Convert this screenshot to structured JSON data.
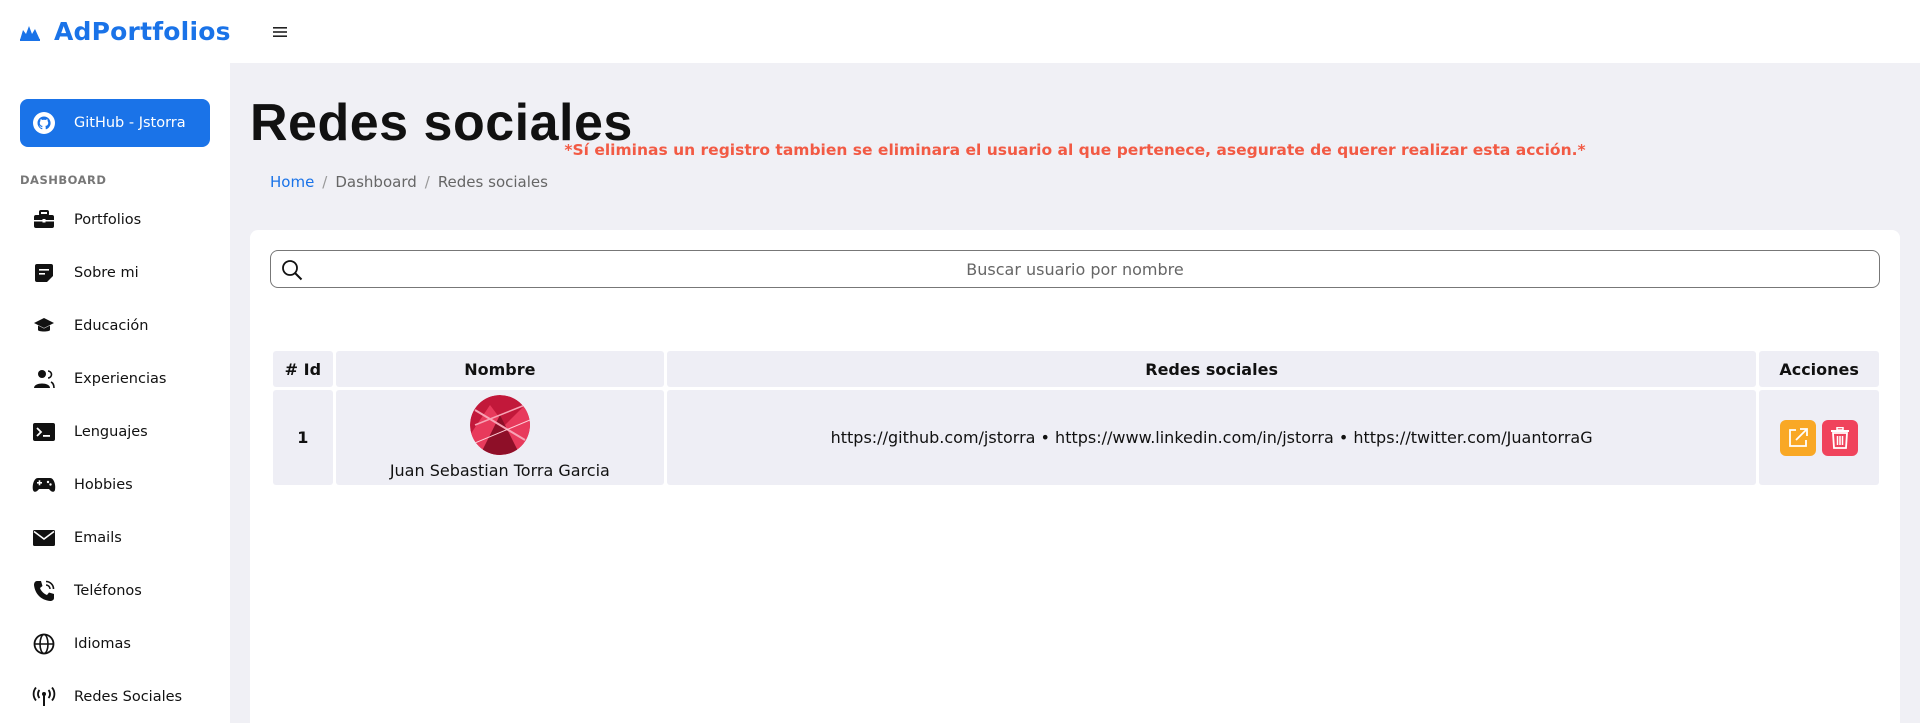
{
  "app": {
    "name": "AdPortfolios",
    "accent": "#1a73e8"
  },
  "sidebar": {
    "github_button": "GitHub - Jstorra",
    "section_label": "DASHBOARD",
    "items": [
      {
        "label": "Portfolios",
        "icon": "briefcase-icon"
      },
      {
        "label": "Sobre mi",
        "icon": "note-icon"
      },
      {
        "label": "Educación",
        "icon": "graduation-cap-icon"
      },
      {
        "label": "Experiencias",
        "icon": "person-icon"
      },
      {
        "label": "Lenguajes",
        "icon": "terminal-icon"
      },
      {
        "label": "Hobbies",
        "icon": "gamepad-icon"
      },
      {
        "label": "Emails",
        "icon": "envelope-icon"
      },
      {
        "label": "Teléfonos",
        "icon": "phone-icon"
      },
      {
        "label": "Idiomas",
        "icon": "globe-icon"
      },
      {
        "label": "Redes Sociales",
        "icon": "broadcast-icon"
      }
    ]
  },
  "main": {
    "title": "Redes sociales",
    "breadcrumb": [
      "Home",
      "Dashboard",
      "Redes sociales"
    ],
    "search_placeholder": "Buscar usuario por nombre",
    "warning": "*Sí eliminas un registro tambien se eliminara el usuario al que pertenece, asegurate de querer realizar esta acción.*",
    "warning_color": "#f25a44",
    "table": {
      "headers": [
        "# Id",
        "Nombre",
        "Redes sociales",
        "Acciones"
      ],
      "rows": [
        {
          "id": "1",
          "nombre": "Juan Sebastian Torra Garcia",
          "redes": "https://github.com/jstorra • https://www.linkedin.com/in/jstorra • https://twitter.com/JuantorraG"
        }
      ]
    },
    "edit_color": "#f9a825",
    "delete_color": "#f0435c"
  }
}
